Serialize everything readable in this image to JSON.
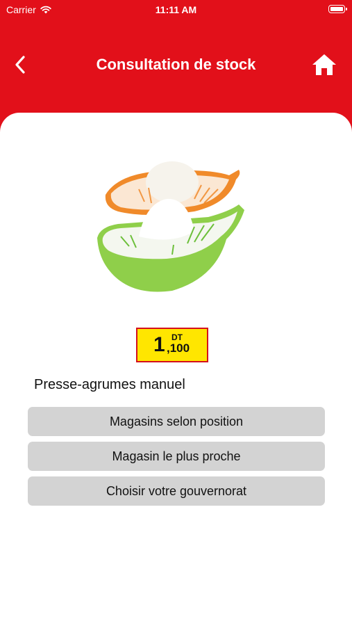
{
  "status_bar": {
    "carrier": "Carrier",
    "time": "11:11 AM"
  },
  "nav": {
    "title": "Consultation de stock"
  },
  "product": {
    "name": "Presse-agrumes manuel",
    "price": {
      "currency": "DT",
      "integer": "1",
      "decimal": ",100"
    }
  },
  "actions": [
    {
      "label": "Magasins selon position"
    },
    {
      "label": "Magasin le plus proche"
    },
    {
      "label": "Choisir votre gouvernorat"
    }
  ],
  "colors": {
    "header": "#e2101a",
    "price_tag": "#ffe600",
    "button": "#d3d3d3"
  },
  "icons": {
    "back": "chevron-left-icon",
    "home": "home-icon",
    "wifi": "wifi-icon",
    "battery": "battery-icon"
  }
}
